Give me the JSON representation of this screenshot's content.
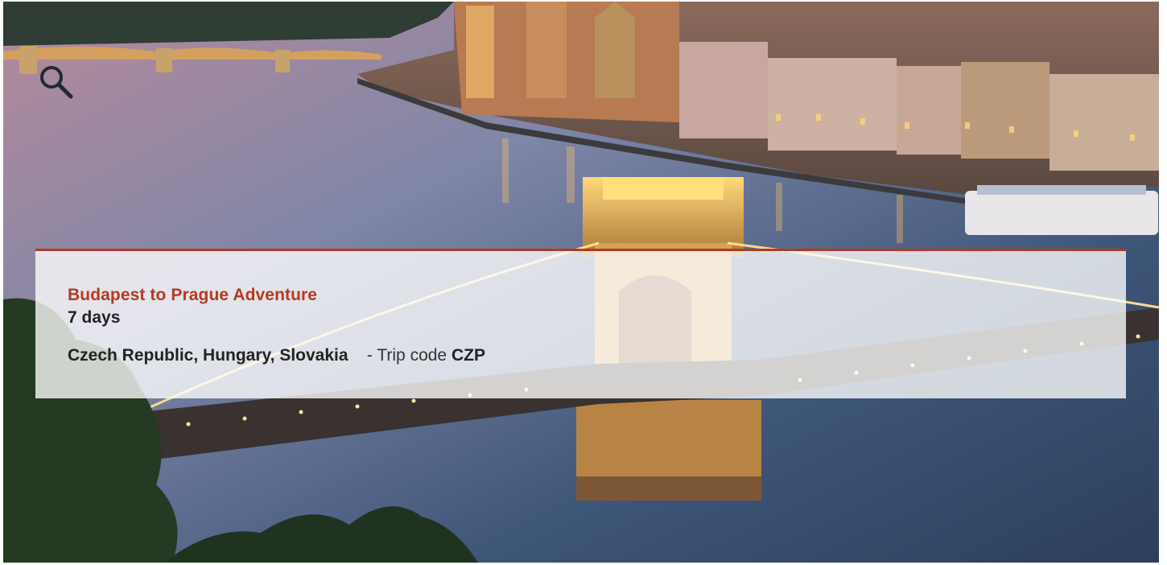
{
  "hero": {
    "image_icon": "night-city-river-bridge-photo"
  },
  "search": {
    "icon": "search-icon"
  },
  "trip": {
    "title": "Budapest to Prague Adventure",
    "duration": "7 days",
    "countries": "Czech Republic, Hungary, Slovakia",
    "code_label": "- Trip code",
    "code": "CZP"
  },
  "colors": {
    "accent": "#b5391f",
    "text": "#222222",
    "panel_bg": "rgba(255,255,255,0.78)"
  }
}
